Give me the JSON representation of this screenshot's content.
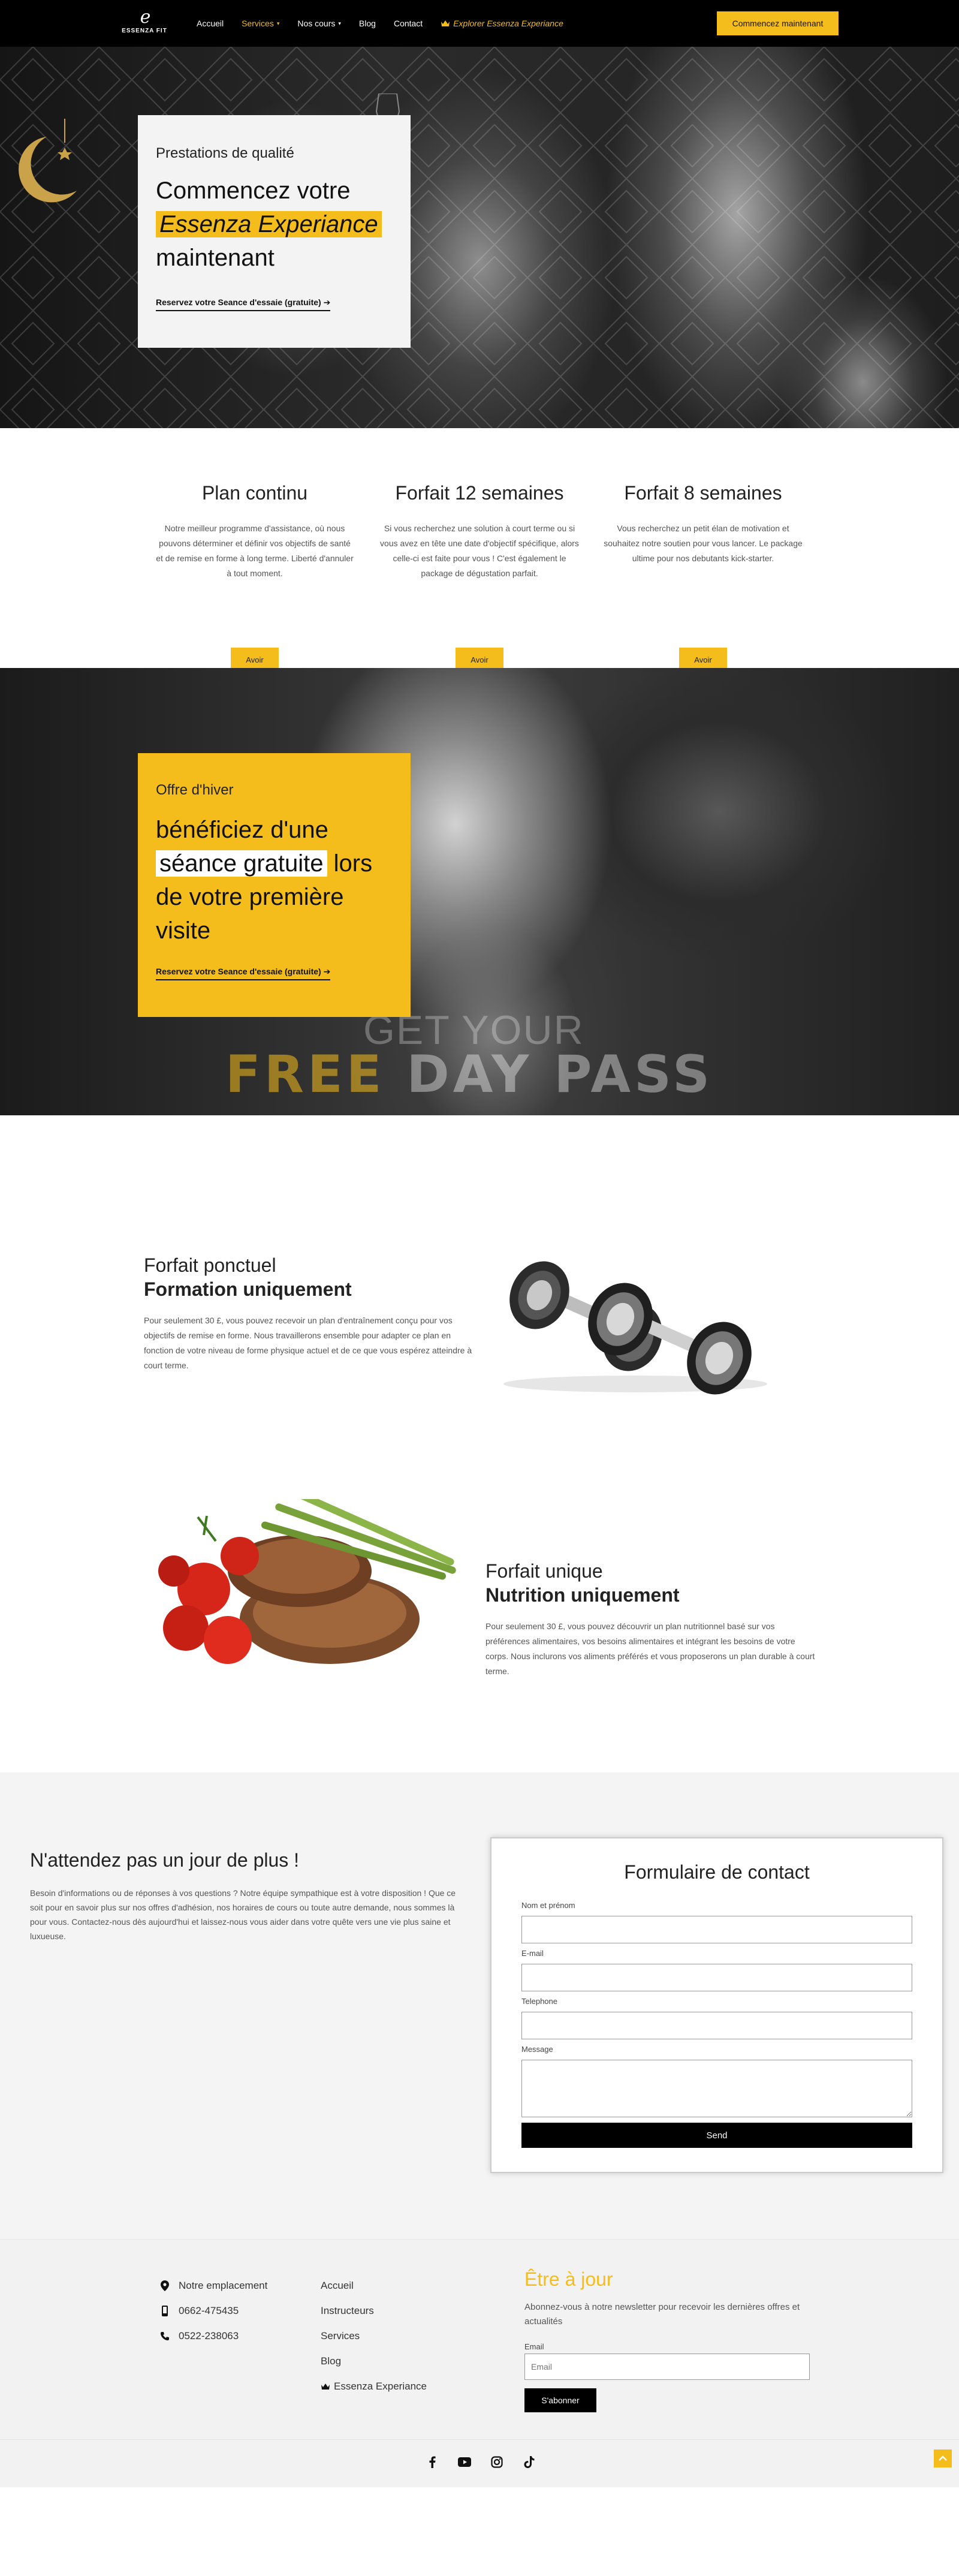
{
  "header": {
    "logo_mark": "e",
    "logo_name": "ESSENZA FIT",
    "nav": {
      "home": "Accueil",
      "services": "Services",
      "courses": "Nos cours",
      "blog": "Blog",
      "contact": "Contact",
      "explore": "Explorer Essenza Experiance"
    },
    "cta": "Commencez maintenant"
  },
  "hero": {
    "kicker": "Prestations de qualité",
    "title_line1": "Commencez votre",
    "title_highlight": "Essenza Experiance",
    "title_line3": "maintenant",
    "link": "Reservez votre Seance d'essaie (gratuite) ➔"
  },
  "plans": [
    {
      "title": "Plan continu",
      "text": "Notre meilleur programme d'assistance, où nous pouvons déterminer et définir vos objectifs de santé et de remise en forme à long terme. Liberté d'annuler à tout moment.",
      "button": "Avoir"
    },
    {
      "title": "Forfait 12 semaines",
      "text": "Si vous recherchez une solution à court terme ou si vous avez en tête une date d'objectif spécifique, alors celle-ci est faite pour vous ! C'est également le package de dégustation parfait.",
      "button": "Avoir"
    },
    {
      "title": "Forfait 8 semaines",
      "text": "Vous recherchez un petit élan de motivation et souhaitez notre soutien pour vous lancer. Le package ultime pour nos debutants kick-starter.",
      "button": "Avoir"
    }
  ],
  "winter": {
    "kicker": "Offre d'hiver",
    "title_line1": "bénéficiez d'une",
    "title_highlight": "séance gratuite",
    "title_after": "lors",
    "title_line3": "de votre première",
    "title_line4": "visite",
    "link": "Reservez votre Seance d'essaie (gratuite) ➔",
    "banner_top": "GET YOUR",
    "banner_free": "FREE",
    "banner_rest": "DAY PASS"
  },
  "training": {
    "title_line1": "Forfait ponctuel",
    "title_line2": "Formation uniquement",
    "text": "Pour seulement 30 £, vous pouvez recevoir un plan d'entraînement conçu pour vos objectifs de remise en forme. Nous travaillerons ensemble pour adapter ce plan en fonction de votre niveau de forme physique actuel et de ce que vous espérez atteindre à court terme."
  },
  "nutrition": {
    "title_line1": "Forfait unique",
    "title_line2": "Nutrition uniquement",
    "text": "Pour seulement 30 £, vous pouvez découvrir un plan nutritionnel basé sur vos préférences alimentaires, vos besoins alimentaires et intégrant les besoins de votre corps. Nous inclurons vos aliments préférés et vous proposerons un plan durable à court terme."
  },
  "contact": {
    "heading": "N'attendez pas un jour de plus !",
    "text": "Besoin d'informations ou de réponses à vos questions ? Notre équipe sympathique est à votre disposition ! Que ce soit pour en savoir plus sur nos offres d'adhésion, nos horaires de cours ou toute autre demande, nous sommes là pour vous. Contactez-nous dès aujourd'hui et laissez-nous vous aider dans votre quête vers une vie plus saine et luxueuse.",
    "form_title": "Formulaire de contact",
    "name_label": "Nom et prénom",
    "email_label": "E-mail",
    "phone_label": "Telephone",
    "message_label": "Message",
    "send": "Send"
  },
  "footer": {
    "location": "Notre emplacement",
    "phone1": "0662-475435",
    "phone2": "0522-238063",
    "links": {
      "home": "Accueil",
      "instructors": "Instructeurs",
      "services": "Services",
      "blog": "Blog",
      "experience": "Essenza Experiance"
    },
    "newsletter_title": "Être à jour",
    "newsletter_text": "Abonnez-vous à notre newsletter pour recevoir les dernières offres et actualités",
    "email_label": "Email",
    "email_placeholder": "Email",
    "subscribe": "S'abonner"
  },
  "icons": {
    "crown": "crown-icon",
    "location": "map-pin-icon",
    "mobile": "mobile-icon",
    "phone": "phone-icon",
    "facebook": "facebook-icon",
    "youtube": "youtube-icon",
    "instagram": "instagram-icon",
    "tiktok": "tiktok-icon",
    "to_top": "chevron-up-icon"
  },
  "colors": {
    "accent": "#f5bd1c",
    "dark": "#000000",
    "light_bg": "#f4f4f4"
  }
}
